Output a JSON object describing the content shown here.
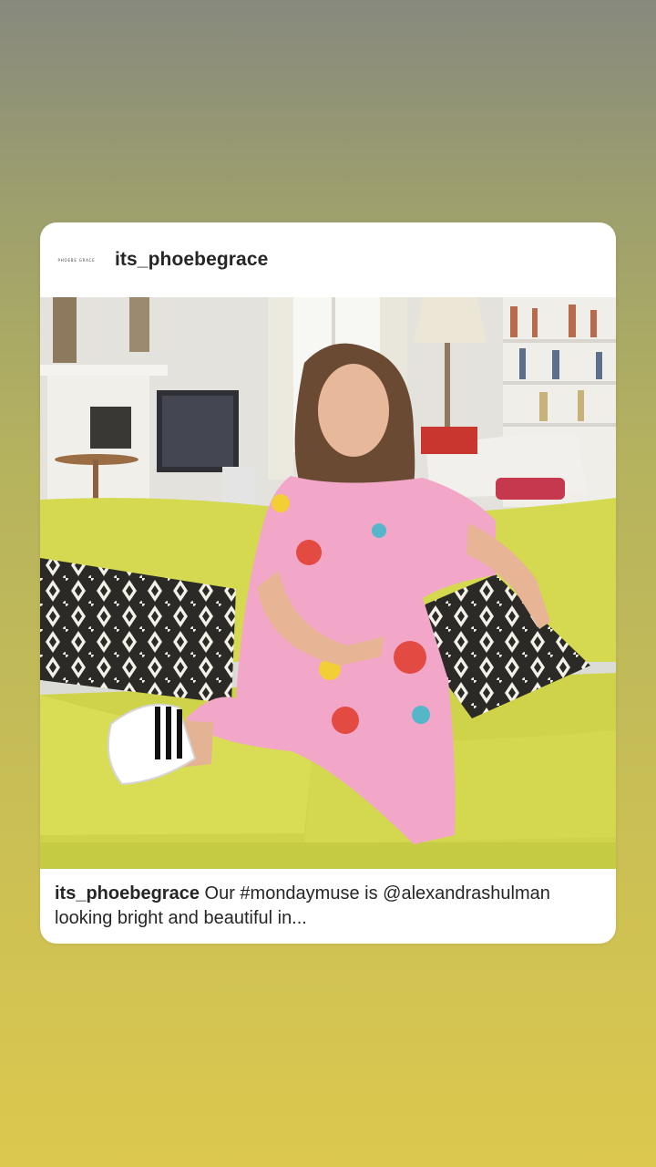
{
  "post": {
    "brand_logo_text": "PHOEBE GRACE",
    "username": "its_phoebegrace",
    "caption": {
      "username": "its_phoebegrace",
      "text": " Our #mondaymuse is @alexandrashulman looking bright and beautiful in..."
    },
    "colors": {
      "sofa": "#d4d94f",
      "dress": "#f2a7c8",
      "background_top": "#87897e",
      "background_bottom": "#dcc84e"
    }
  }
}
